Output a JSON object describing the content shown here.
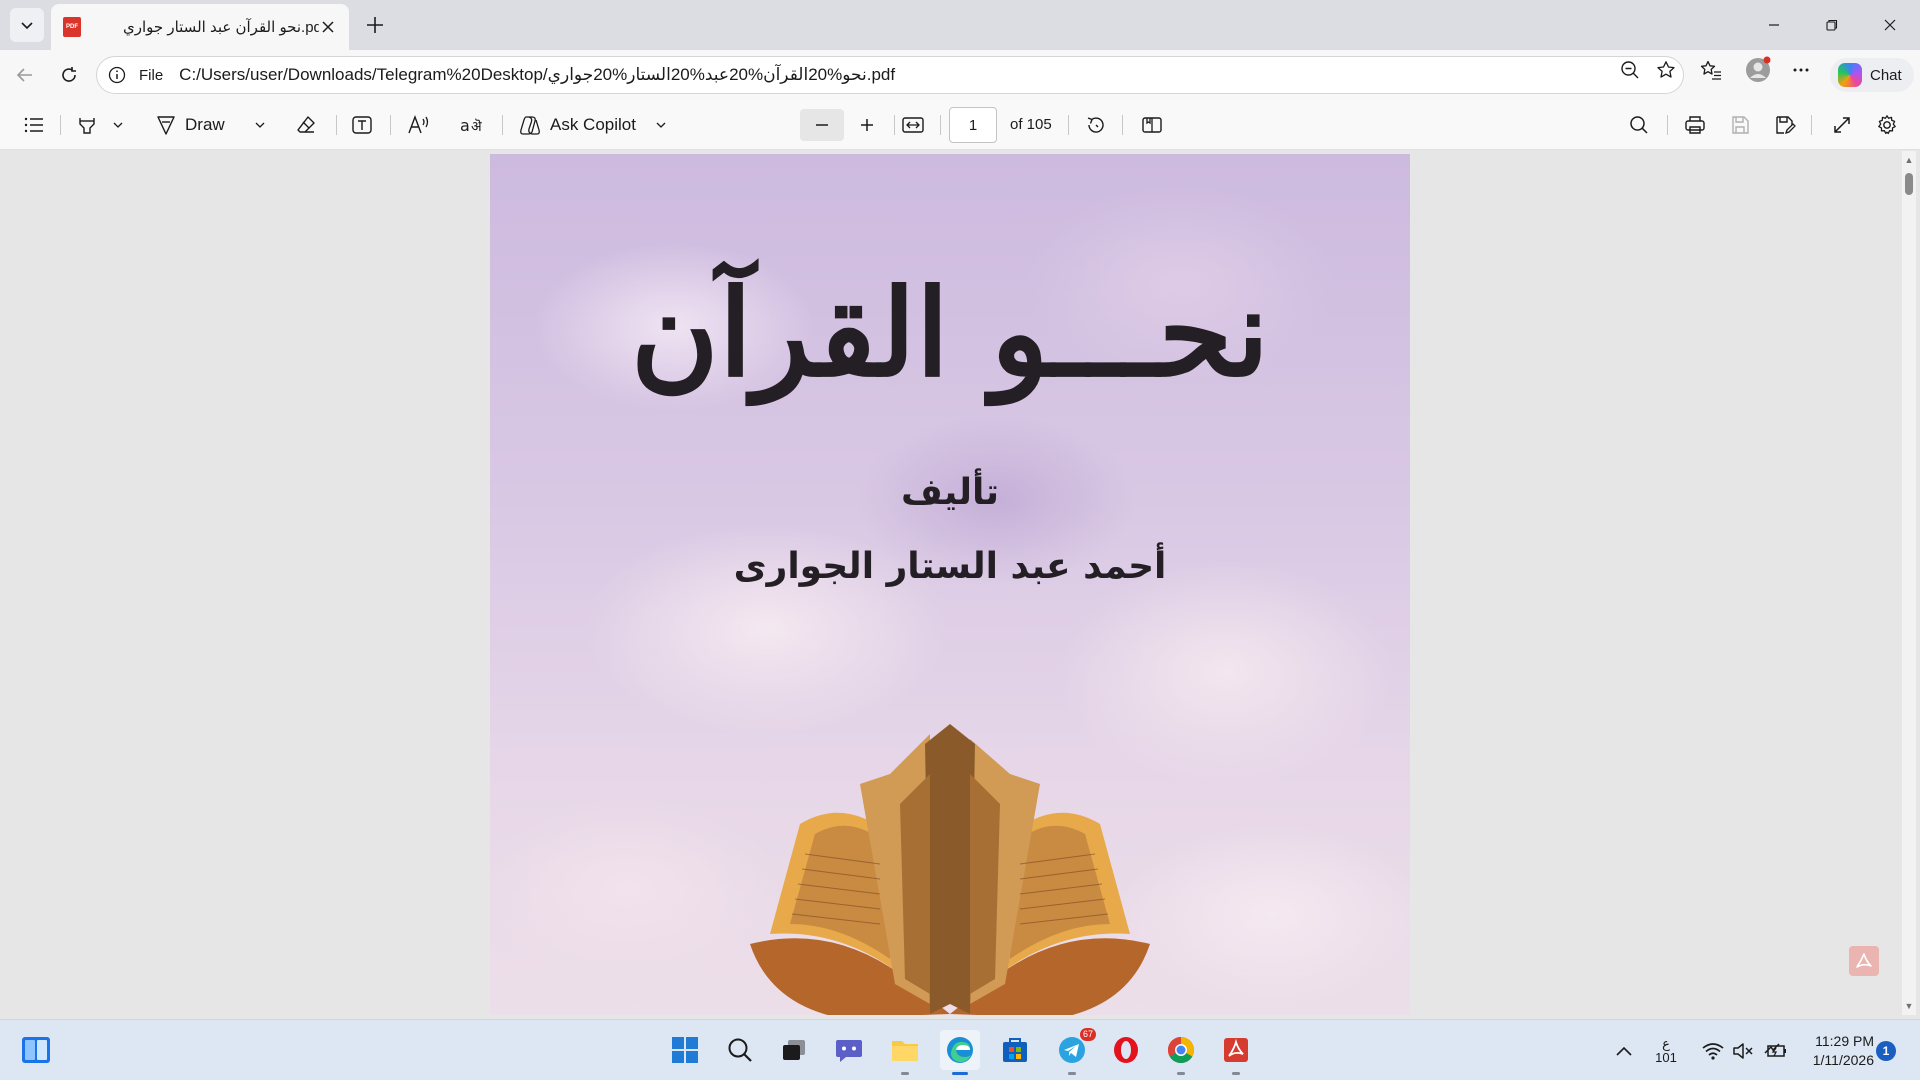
{
  "browser": {
    "tab": {
      "title": "نحو القرآن عبد الستار جواري.pdf",
      "favicon_label": "PDF"
    },
    "address": {
      "scheme_label": "File",
      "url": "C:/Users/user/Downloads/Telegram%20Desktop/نحو%20القرآن%20عبد%20الستار%20جواري.pdf"
    },
    "chat_label": "Chat"
  },
  "pdf_toolbar": {
    "draw_label": "Draw",
    "ask_copilot_label": "Ask Copilot",
    "page_current": "1",
    "page_count_label": "of 105"
  },
  "document": {
    "title": "نحـــو القرآن",
    "by_label": "تأليف",
    "author": "أحمد عبد الستار الجوارى"
  },
  "taskbar": {
    "telegram_badge": "67",
    "input_lang_top": "ع",
    "input_lang_bottom": "101",
    "time": "11:29 PM",
    "date": "1/11/2026",
    "notifications": "1"
  }
}
